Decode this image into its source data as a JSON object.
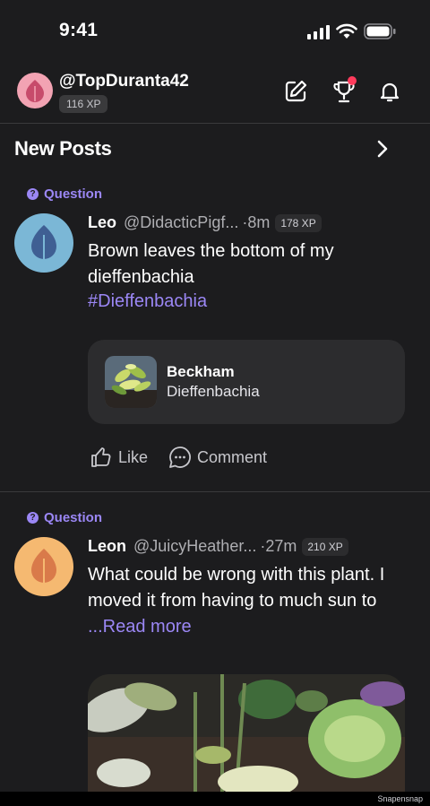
{
  "status_bar": {
    "time": "9:41"
  },
  "profile": {
    "username": "@TopDuranta42",
    "xp": "116 XP"
  },
  "section": {
    "title": "New Posts"
  },
  "posts": [
    {
      "tag": "Question",
      "name": "Leo",
      "handle": "@DidacticPigf...",
      "time": "·8m",
      "xp": "178 XP",
      "text": "Brown leaves the bottom of my dieffenbachia",
      "hashtag": "#Dieffenbachia",
      "plant": {
        "name": "Beckham",
        "species": "Dieffenbachia"
      },
      "like_label": "Like",
      "comment_label": "Comment",
      "avatar_color": "#7bb7d6",
      "leaf_color": "#3f5f93"
    },
    {
      "tag": "Question",
      "name": "Leon",
      "handle": "@JuicyHeather...",
      "time": "·27m",
      "xp": "210 XP",
      "text": "What could be wrong with this plant.  I moved it from having to much sun to ",
      "read_more": "...Read more",
      "avatar_color": "#f5b971",
      "leaf_color": "#d97a4a"
    }
  ],
  "watermark": "Snapensnap",
  "colors": {
    "accent": "#9b87f5",
    "background": "#1c1c1e",
    "notification": "#ff3b5c"
  }
}
